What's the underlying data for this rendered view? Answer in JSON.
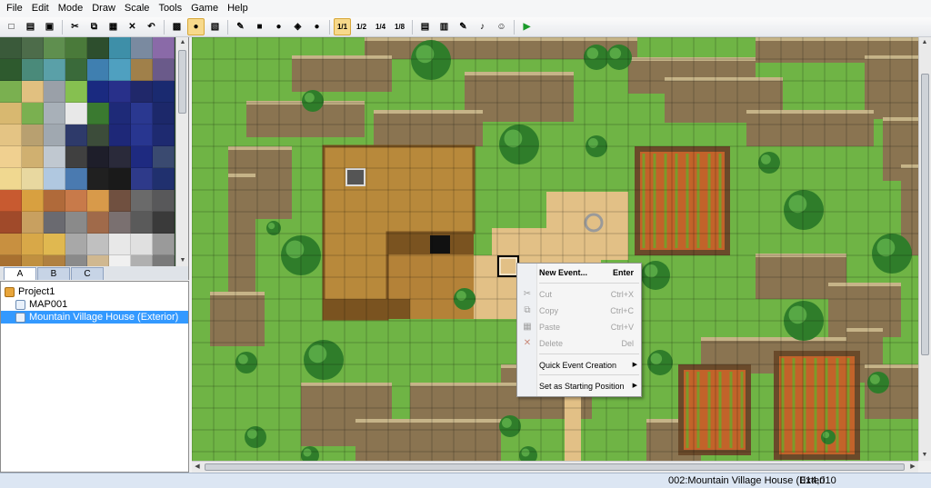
{
  "menubar": {
    "items": [
      "File",
      "Edit",
      "Mode",
      "Draw",
      "Scale",
      "Tools",
      "Game",
      "Help"
    ]
  },
  "toolbar": {
    "buttons": [
      {
        "name": "new-project-icon",
        "glyph": "□"
      },
      {
        "name": "open-project-icon",
        "glyph": "▤"
      },
      {
        "name": "save-project-icon",
        "glyph": "▣"
      },
      {
        "name": "cut-icon",
        "glyph": "✂"
      },
      {
        "name": "copy-icon",
        "glyph": "⧉"
      },
      {
        "name": "paste-icon",
        "glyph": "▦"
      },
      {
        "name": "delete-icon",
        "glyph": "✕"
      },
      {
        "name": "undo-icon",
        "glyph": "↶"
      },
      {
        "name": "map-layer-icon",
        "glyph": "▩"
      },
      {
        "name": "event-layer-icon",
        "glyph": "●"
      },
      {
        "name": "region-layer-icon",
        "glyph": "▧"
      },
      {
        "name": "pencil-icon",
        "glyph": "✎"
      },
      {
        "name": "rectangle-icon",
        "glyph": "■"
      },
      {
        "name": "ellipse-icon",
        "glyph": "●"
      },
      {
        "name": "fill-icon",
        "glyph": "◈"
      },
      {
        "name": "shadow-pen-icon",
        "glyph": "●"
      },
      {
        "name": "zoom-1-1-icon",
        "glyph": "1/1"
      },
      {
        "name": "zoom-1-2-icon",
        "glyph": "1/2"
      },
      {
        "name": "zoom-1-4-icon",
        "glyph": "1/4"
      },
      {
        "name": "zoom-1-8-icon",
        "glyph": "1/8"
      },
      {
        "name": "database-icon",
        "glyph": "▤"
      },
      {
        "name": "resource-manager-icon",
        "glyph": "▥"
      },
      {
        "name": "script-editor-icon",
        "glyph": "✎"
      },
      {
        "name": "sound-test-icon",
        "glyph": "♪"
      },
      {
        "name": "character-generator-icon",
        "glyph": "☺"
      },
      {
        "name": "playtest-icon",
        "glyph": "▶"
      }
    ]
  },
  "tabs": [
    "A",
    "B",
    "C"
  ],
  "tree": {
    "project": "Project1",
    "maps": [
      "MAP001",
      "Mountain Village House (Exterior)"
    ]
  },
  "context_menu": {
    "items": [
      {
        "label": "New Event...",
        "shortcut": "Enter",
        "enabled": true,
        "bold": true
      },
      {
        "label": "Cut",
        "shortcut": "Ctrl+X",
        "enabled": false
      },
      {
        "label": "Copy",
        "shortcut": "Ctrl+C",
        "enabled": false
      },
      {
        "label": "Paste",
        "shortcut": "Ctrl+V",
        "enabled": false
      },
      {
        "label": "Delete",
        "shortcut": "Del",
        "enabled": false
      },
      {
        "label": "Quick Event Creation",
        "shortcut": "",
        "enabled": true,
        "submenu": true
      },
      {
        "label": "Set as Starting Position",
        "shortcut": "",
        "enabled": true,
        "submenu": true
      }
    ]
  },
  "status": {
    "map_name": "002:Mountain Village House (Exteri",
    "coords": "014,010"
  },
  "colors": {
    "grass": "#6fb445",
    "cliff": "#8a7451",
    "roof": "#b8893b",
    "path": "#e2c086",
    "tree": "#2f7d2a",
    "crops": "#c2632a"
  }
}
